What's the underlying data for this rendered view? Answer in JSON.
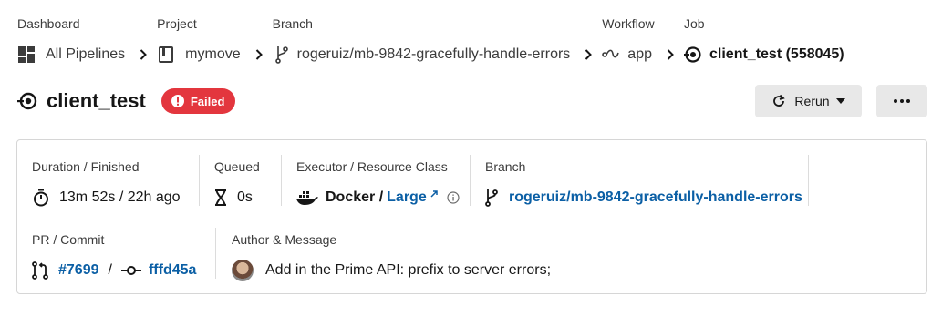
{
  "breadcrumb": {
    "items": [
      {
        "caption": "Dashboard",
        "value": "All Pipelines",
        "icon": "dashboard-icon"
      },
      {
        "caption": "Project",
        "value": "mymove",
        "icon": "project-icon"
      },
      {
        "caption": "Branch",
        "value": "rogeruiz/mb-9842-gracefully-handle-errors",
        "icon": "branch-icon"
      },
      {
        "caption": "Workflow",
        "value": "app",
        "icon": "workflow-icon"
      },
      {
        "caption": "Job",
        "value": "client_test (558045)",
        "icon": "job-icon"
      }
    ],
    "separator_icon": "chevron-right-icon"
  },
  "header": {
    "title": "client_test",
    "status": "Failed",
    "status_color": "#e3363e",
    "rerun_label": "Rerun",
    "more_icon": "more-horizontal-icon"
  },
  "details": {
    "duration": {
      "caption": "Duration / Finished",
      "value": "13m 52s / 22h ago",
      "icon": "stopwatch-icon"
    },
    "queued": {
      "caption": "Queued",
      "value": "0s",
      "icon": "hourglass-icon"
    },
    "executor": {
      "caption": "Executor / Resource Class",
      "value": "Docker / ",
      "link": "Large",
      "icon": "docker-icon"
    },
    "branch": {
      "caption": "Branch",
      "value": "rogeruiz/mb-9842-gracefully-handle-errors",
      "icon": "branch-icon"
    },
    "pr_commit": {
      "caption": "PR / Commit",
      "pr": "#7699",
      "sep": "/",
      "commit": "fffd45a"
    },
    "author": {
      "caption": "Author & Message",
      "message": "Add in the Prime API: prefix to server errors;"
    }
  },
  "colors": {
    "link": "#0b5fa5",
    "button_bg": "#e8e8e8",
    "card_border": "#d6d6d6"
  }
}
